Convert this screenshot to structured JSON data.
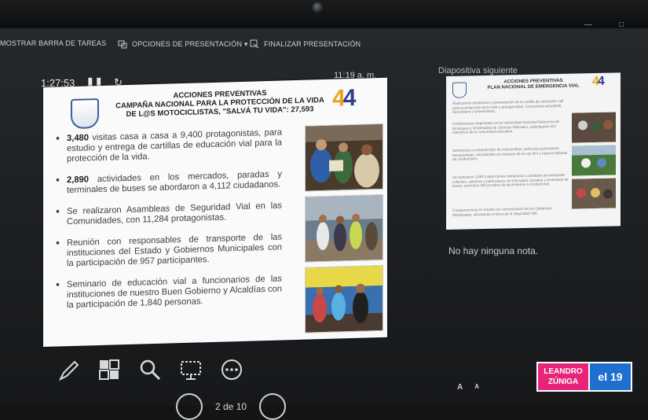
{
  "topbar": {
    "taskbar_label": "MOSTRAR BARRA DE TAREAS",
    "options_label": "OPCIONES DE PRESENTACIÓN ▾",
    "end_label": "FINALIZAR PRESENTACIÓN"
  },
  "presenter": {
    "timer": "1:27:53",
    "clock": "11:19 a. m.",
    "next_slide_label": "Diapositiva siguiente",
    "notes": "No hay ninguna nota.",
    "page": "2 de 10",
    "font_buttons": [
      "A",
      "A"
    ]
  },
  "slide": {
    "title_lines": [
      "ACCIONES PREVENTIVAS",
      "CAMPAÑA NACIONAL PARA LA PROTECCIÓN DE LA VIDA",
      "DE L@S MOTOCICLISTAS,  \"SALVÁ TU VIDA\": 27,593"
    ],
    "logo_text": "4",
    "bullets": [
      {
        "bold": "3,480",
        "text": " visitas casa a casa a 9,400 protagonistas, para estudio y entrega de cartillas de educación vial para la protección de la vida."
      },
      {
        "bold": "2,890",
        "text": " actividades en los mercados, paradas y terminales de buses se abordaron a 4,112 ciudadanos."
      },
      {
        "bold": "",
        "text": "Se realizaron Asambleas de Seguridad Vial en las Comunidades, con 11,284 protagonistas."
      },
      {
        "bold": "",
        "text": "Reunión con responsables de transporte de las instituciones del Estado y Gobiernos Municipales con la participación de 957 participantes."
      },
      {
        "bold": "",
        "text": "Seminario de educación vial a funcionarios de las instituciones de nuestro Buen Gobierno y Alcaldías con la participación de 1,840 personas."
      }
    ]
  },
  "next_slide": {
    "title_lines": [
      "ACCIONES PREVENTIVAS",
      "PLAN NACIONAL DE EMERGENCIA VIAL"
    ],
    "logo_text": "4",
    "body": [
      "Realizamos seminarios y presentación de la cartilla de educación vial para la protección de la vida a protagonistas: Comunidad estudiantil, Secundaria y Universitaria.",
      "Conferencias magistrales en la Universidad Nacional Autónoma de Nicaragua y Universidad de Ciencias Policiales, participando 507 miembros de la comunidad educativa.",
      "Seminarios a conductor@s de motocicletas, vehículos particulares, transportistas, reincidentes en violación de la Ley 431 y nuevos titulares de conductores.",
      "Se realizaron 3,662 inspecciones mecánicas a unidades de transporte colectivo, selectivo y particulares, en mercados, paradas y terminales de buses, asimismo 265 pruebas de alcoholemia a conductores.",
      "Comparecencia en medios de comunicación de los Gobiernos Municipales, abordando el tema de la Seguridad Vial."
    ]
  },
  "watermark": {
    "line1": "LEANDRO",
    "line2": "ZÚNIGA",
    "logo": "el 19"
  },
  "colors": {
    "slide_bg": "#fafafa",
    "logo_blue": "#2f3e8f",
    "logo_orange": "#e8a21c",
    "wm_pink": "#e8247a",
    "wm_blue": "#1f6fd1"
  }
}
